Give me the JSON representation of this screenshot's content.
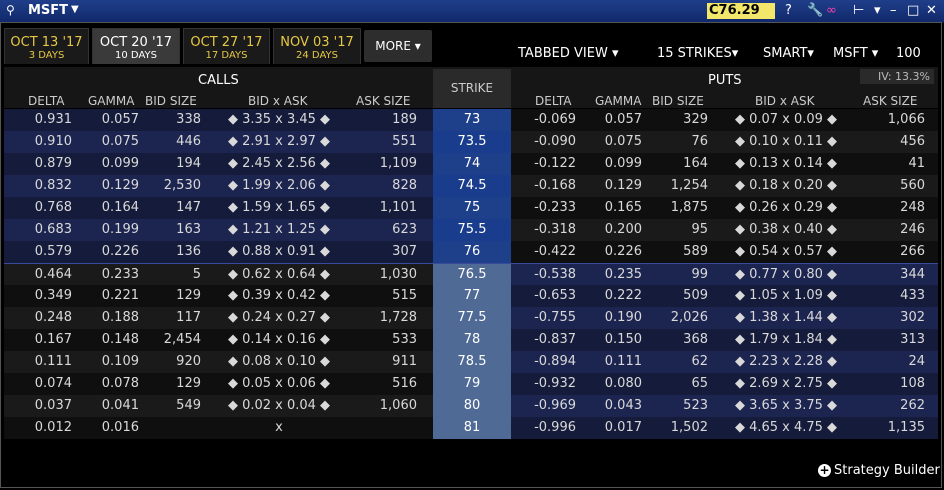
{
  "titlebar": {
    "symbol": "MSFT",
    "price": "C76.29",
    "icons": [
      "link-icon",
      "help-icon",
      "wrench-icon",
      "chain-icon",
      "pin-icon",
      "caret-icon",
      "minimize-icon",
      "maximize-icon",
      "close-icon"
    ],
    "help": "?",
    "caret": "▼",
    "link_glyph": "⚲"
  },
  "tabs": [
    {
      "date": "OCT 13 '17",
      "days": "3 DAYS"
    },
    {
      "date": "OCT 20 '17",
      "days": "10 DAYS"
    },
    {
      "date": "OCT 27 '17",
      "days": "17 DAYS"
    },
    {
      "date": "NOV 03 '17",
      "days": "24 DAYS"
    }
  ],
  "more_label": "MORE ▾",
  "controls": {
    "view": "TABBED VIEW",
    "strikes": "15 STRIKES",
    "exchange": "SMART",
    "underlying": "MSFT",
    "quantity": "100"
  },
  "calls_label": "CALLS",
  "puts_label": "PUTS",
  "iv": "IV: 13.3%",
  "strike_header": "STRIKE",
  "calls_columns": [
    "DELTA",
    "GAMMA",
    "BID SIZE",
    "BID x  ASK",
    "ASK SIZE"
  ],
  "puts_columns": [
    "DELTA",
    "GAMMA",
    "BID SIZE",
    "BID x  ASK",
    "ASK SIZE"
  ],
  "rows": [
    {
      "strike": "73",
      "c_delta": "0.931",
      "c_gamma": "0.057",
      "c_bsize": "338",
      "c_bidask": "◆ 3.35 x 3.45 ◆",
      "c_asize": "189",
      "p_delta": "-0.069",
      "p_gamma": "0.057",
      "p_bsize": "329",
      "p_bidask": "◆ 0.07 x 0.09 ◆",
      "p_asize": "1,066"
    },
    {
      "strike": "73.5",
      "c_delta": "0.910",
      "c_gamma": "0.075",
      "c_bsize": "446",
      "c_bidask": "◆ 2.91 x 2.97 ◆",
      "c_asize": "551",
      "p_delta": "-0.090",
      "p_gamma": "0.075",
      "p_bsize": "76",
      "p_bidask": "◆ 0.10 x 0.11 ◆",
      "p_asize": "456"
    },
    {
      "strike": "74",
      "c_delta": "0.879",
      "c_gamma": "0.099",
      "c_bsize": "194",
      "c_bidask": "◆ 2.45 x 2.56 ◆",
      "c_asize": "1,109",
      "p_delta": "-0.122",
      "p_gamma": "0.099",
      "p_bsize": "164",
      "p_bidask": "◆ 0.13 x 0.14 ◆",
      "p_asize": "41"
    },
    {
      "strike": "74.5",
      "c_delta": "0.832",
      "c_gamma": "0.129",
      "c_bsize": "2,530",
      "c_bidask": "◆ 1.99 x 2.06 ◆",
      "c_asize": "828",
      "p_delta": "-0.168",
      "p_gamma": "0.129",
      "p_bsize": "1,254",
      "p_bidask": "◆ 0.18 x 0.20 ◆",
      "p_asize": "560"
    },
    {
      "strike": "75",
      "c_delta": "0.768",
      "c_gamma": "0.164",
      "c_bsize": "147",
      "c_bidask": "◆ 1.59 x 1.65 ◆",
      "c_asize": "1,101",
      "p_delta": "-0.233",
      "p_gamma": "0.165",
      "p_bsize": "1,875",
      "p_bidask": "◆ 0.26 x 0.29 ◆",
      "p_asize": "248"
    },
    {
      "strike": "75.5",
      "c_delta": "0.683",
      "c_gamma": "0.199",
      "c_bsize": "163",
      "c_bidask": "◆ 1.21 x 1.25 ◆",
      "c_asize": "623",
      "p_delta": "-0.318",
      "p_gamma": "0.200",
      "p_bsize": "95",
      "p_bidask": "◆ 0.38 x 0.40 ◆",
      "p_asize": "246"
    },
    {
      "strike": "76",
      "c_delta": "0.579",
      "c_gamma": "0.226",
      "c_bsize": "136",
      "c_bidask": "◆ 0.88 x 0.91 ◆",
      "c_asize": "307",
      "p_delta": "-0.422",
      "p_gamma": "0.226",
      "p_bsize": "589",
      "p_bidask": "◆ 0.54 x 0.57 ◆",
      "p_asize": "266"
    },
    {
      "strike": "76.5",
      "c_delta": "0.464",
      "c_gamma": "0.233",
      "c_bsize": "5",
      "c_bidask": "◆ 0.62 x 0.64 ◆",
      "c_asize": "1,030",
      "p_delta": "-0.538",
      "p_gamma": "0.235",
      "p_bsize": "99",
      "p_bidask": "◆ 0.77 x 0.80 ◆",
      "p_asize": "344"
    },
    {
      "strike": "77",
      "c_delta": "0.349",
      "c_gamma": "0.221",
      "c_bsize": "129",
      "c_bidask": "◆ 0.39 x 0.42 ◆",
      "c_asize": "515",
      "p_delta": "-0.653",
      "p_gamma": "0.222",
      "p_bsize": "509",
      "p_bidask": "◆ 1.05 x 1.09 ◆",
      "p_asize": "433"
    },
    {
      "strike": "77.5",
      "c_delta": "0.248",
      "c_gamma": "0.188",
      "c_bsize": "117",
      "c_bidask": "◆ 0.24 x 0.27 ◆",
      "c_asize": "1,728",
      "p_delta": "-0.755",
      "p_gamma": "0.190",
      "p_bsize": "2,026",
      "p_bidask": "◆ 1.38 x 1.44 ◆",
      "p_asize": "302"
    },
    {
      "strike": "78",
      "c_delta": "0.167",
      "c_gamma": "0.148",
      "c_bsize": "2,454",
      "c_bidask": "◆ 0.14 x 0.16 ◆",
      "c_asize": "533",
      "p_delta": "-0.837",
      "p_gamma": "0.150",
      "p_bsize": "368",
      "p_bidask": "◆ 1.79 x 1.84 ◆",
      "p_asize": "313"
    },
    {
      "strike": "78.5",
      "c_delta": "0.111",
      "c_gamma": "0.109",
      "c_bsize": "920",
      "c_bidask": "◆ 0.08 x 0.10 ◆",
      "c_asize": "911",
      "p_delta": "-0.894",
      "p_gamma": "0.111",
      "p_bsize": "62",
      "p_bidask": "◆ 2.23 x 2.28 ◆",
      "p_asize": "24"
    },
    {
      "strike": "79",
      "c_delta": "0.074",
      "c_gamma": "0.078",
      "c_bsize": "129",
      "c_bidask": "◆ 0.05 x 0.06 ◆",
      "c_asize": "516",
      "p_delta": "-0.932",
      "p_gamma": "0.080",
      "p_bsize": "65",
      "p_bidask": "◆ 2.69 x 2.75 ◆",
      "p_asize": "108"
    },
    {
      "strike": "80",
      "c_delta": "0.037",
      "c_gamma": "0.041",
      "c_bsize": "549",
      "c_bidask": "◆ 0.02 x 0.04 ◆",
      "c_asize": "1,060",
      "p_delta": "-0.969",
      "p_gamma": "0.043",
      "p_bsize": "523",
      "p_bidask": "◆ 3.65 x 3.75 ◆",
      "p_asize": "262"
    },
    {
      "strike": "81",
      "c_delta": "0.012",
      "c_gamma": "0.016",
      "c_bsize": "",
      "c_bidask": "x",
      "c_asize": "",
      "p_delta": "-0.996",
      "p_gamma": "0.017",
      "p_bsize": "1,502",
      "p_bidask": "◆ 4.65 x 4.75 ◆",
      "p_asize": "1,135"
    }
  ],
  "footer": {
    "label": "Strategy Builder"
  },
  "colors": {
    "itm_call": "#151b3a",
    "itm_call_alt": "#1c2450",
    "itm_put": "#151b3a",
    "strike_itm": "#1e3f8a",
    "strike_otm": "#4f6a95",
    "otm_bg": "#0f0f0f",
    "otm_alt": "#1a1a1a"
  }
}
